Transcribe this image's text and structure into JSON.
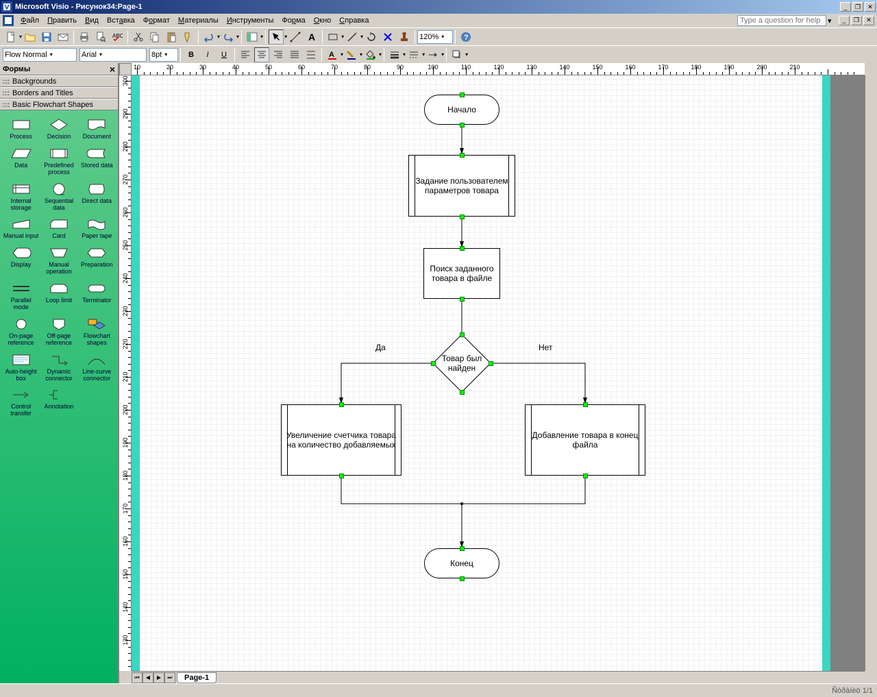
{
  "app": {
    "name": "Microsoft Visio",
    "doc": "Рисунок34:Page-1"
  },
  "menu": [
    "Файл",
    "Править",
    "Вид",
    "Вставка",
    "Формат",
    "Материалы",
    "Инструменты",
    "Форма",
    "Окно",
    "Справка"
  ],
  "help_placeholder": "Type a question for help",
  "toolbar2": {
    "style": "Flow Normal",
    "font": "Arial",
    "size": "8pt"
  },
  "zoom": "120%",
  "shapes_panel": {
    "title": "Формы",
    "stencils": [
      "Backgrounds",
      "Borders and Titles",
      "Basic Flowchart Shapes"
    ],
    "shapes": [
      "Process",
      "Decision",
      "Document",
      "Data",
      "Predefined process",
      "Stored data",
      "Internal storage",
      "Sequential data",
      "Direct data",
      "Manual input",
      "Card",
      "Paper tape",
      "Display",
      "Manual operation",
      "Preparation",
      "Parallel mode",
      "Loop limit",
      "Terminator",
      "On-page reference",
      "Off-page reference",
      "Flowchart shapes",
      "Auto-height box",
      "Dynamic connector",
      "Line-curve connector",
      "Control transfer",
      "Annotation"
    ]
  },
  "flowchart": {
    "start": "Начало",
    "step1": "Задание пользователем параметров товара",
    "step2": "Поиск заданного товара в файле",
    "decision": "Товар был найден",
    "yes": "Да",
    "no": "Нет",
    "left": "Увеличение счетчика товара на количество добавляемых",
    "right": "Добавление товара в конец файла",
    "end": "Конец"
  },
  "page_tab": "Page-1",
  "status_right": "Ñòðàíèö 1/1",
  "ruler_h": [
    10,
    20,
    30,
    40,
    50,
    60,
    70,
    80,
    90,
    100,
    110,
    120,
    130,
    140,
    150,
    160,
    170,
    180,
    190,
    200,
    210
  ],
  "ruler_v": [
    300,
    290,
    280,
    270,
    260,
    250,
    240,
    230,
    220,
    210,
    200,
    190,
    180,
    170,
    160,
    150,
    140,
    130
  ]
}
